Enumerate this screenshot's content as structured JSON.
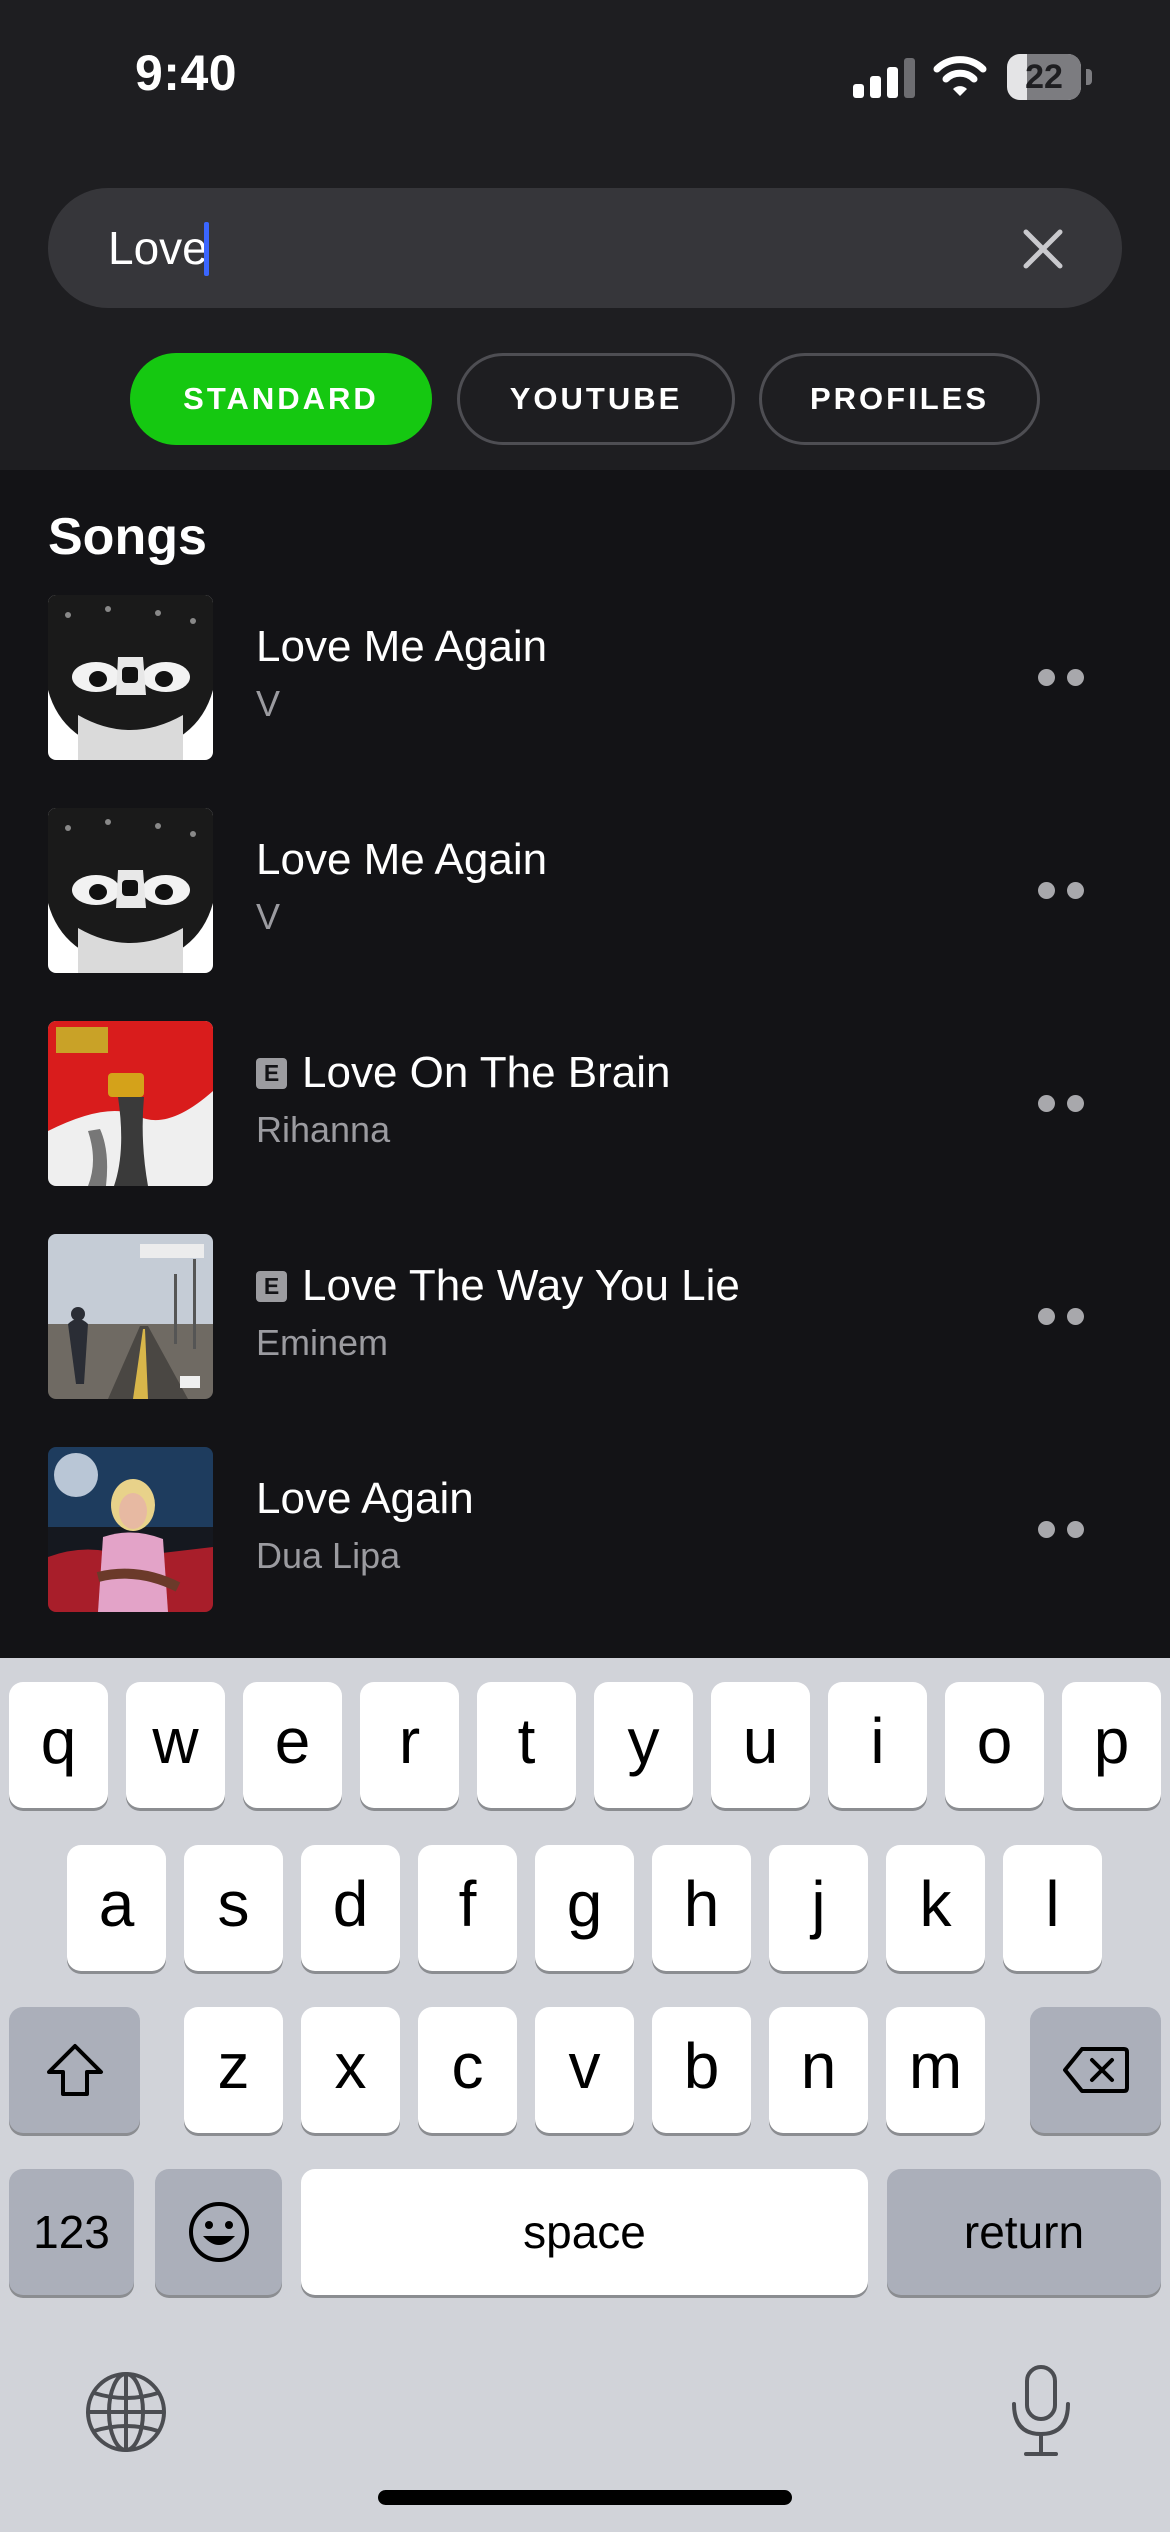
{
  "status_bar": {
    "time": "9:40",
    "battery": "22"
  },
  "search": {
    "query": "Love"
  },
  "filters": [
    {
      "label": "STANDARD",
      "active": true
    },
    {
      "label": "YOUTUBE",
      "active": false
    },
    {
      "label": "PROFILES",
      "active": false
    }
  ],
  "results": {
    "section_title": "Songs",
    "songs": [
      {
        "title": "Love Me Again",
        "artist": "V",
        "explicit": false
      },
      {
        "title": "Love Me Again",
        "artist": "V",
        "explicit": false
      },
      {
        "title": "Love On The Brain",
        "artist": "Rihanna",
        "explicit": true,
        "badge": "E"
      },
      {
        "title": "Love The Way You Lie",
        "artist": "Eminem",
        "explicit": true,
        "badge": "E"
      },
      {
        "title": "Love Again",
        "artist": "Dua Lipa",
        "explicit": false
      }
    ]
  },
  "keyboard": {
    "row1": [
      "q",
      "w",
      "e",
      "r",
      "t",
      "y",
      "u",
      "i",
      "o",
      "p"
    ],
    "row2": [
      "a",
      "s",
      "d",
      "f",
      "g",
      "h",
      "j",
      "k",
      "l"
    ],
    "row3": [
      "z",
      "x",
      "c",
      "v",
      "b",
      "n",
      "m"
    ],
    "numbers_label": "123",
    "space_label": "space",
    "return_label": "return"
  },
  "colors": {
    "accent_green": "#15c811",
    "cursor_blue": "#3a66ff",
    "background": "#131316"
  }
}
